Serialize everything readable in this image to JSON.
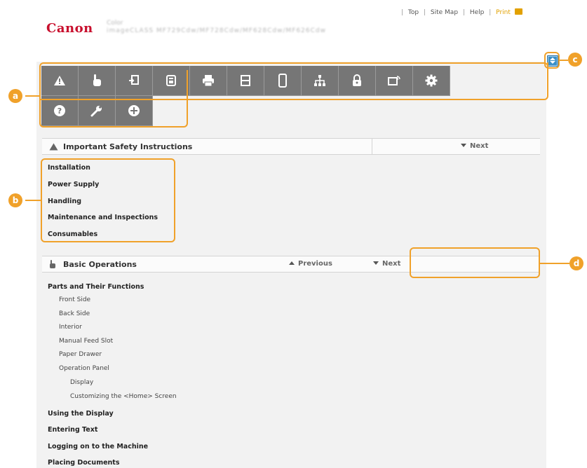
{
  "header": {
    "brand": "Canon",
    "model_line1": "Color",
    "model_line2": "imageCLASS MF729Cdw/MF728Cdw/MF628Cdw/MF626Cdw",
    "links": [
      "Top",
      "Site Map",
      "Help"
    ],
    "print_label": "Print"
  },
  "callouts": {
    "a": "a",
    "b": "b",
    "c": "c",
    "d": "d"
  },
  "colors": {
    "accent": "#f0a12a",
    "icon_bg": "#767676",
    "brand": "#c8102e",
    "top_button": "#3b8fc7"
  },
  "icon_bar": [
    "warning-icon",
    "hand-icon",
    "copy-icon",
    "fax-icon",
    "print-icon",
    "scan-icon",
    "mobile-icon",
    "network-icon",
    "lock-icon",
    "remote-ui-icon",
    "gear-icon",
    "help-icon",
    "wrench-icon",
    "plus-icon"
  ],
  "safety": {
    "title": "Important Safety Instructions",
    "next_label": "Next",
    "links": [
      "Installation",
      "Power Supply",
      "Handling",
      "Maintenance and Inspections",
      "Consumables"
    ]
  },
  "basic": {
    "title": "Basic Operations",
    "previous_label": "Previous",
    "next_label": "Next",
    "items": [
      {
        "text": "Parts and Their Functions",
        "level": 0
      },
      {
        "text": "Front Side",
        "level": 1
      },
      {
        "text": "Back Side",
        "level": 1
      },
      {
        "text": "Interior",
        "level": 1
      },
      {
        "text": "Manual Feed Slot",
        "level": 1
      },
      {
        "text": "Paper Drawer",
        "level": 1
      },
      {
        "text": "Operation Panel",
        "level": 1
      },
      {
        "text": "Display",
        "level": 2
      },
      {
        "text": "Customizing the <Home> Screen",
        "level": 2
      },
      {
        "text": "Using the Display",
        "level": 0
      },
      {
        "text": "Entering Text",
        "level": 0
      },
      {
        "text": "Logging on to the Machine",
        "level": 0
      },
      {
        "text": "Placing Documents",
        "level": 0
      }
    ]
  }
}
